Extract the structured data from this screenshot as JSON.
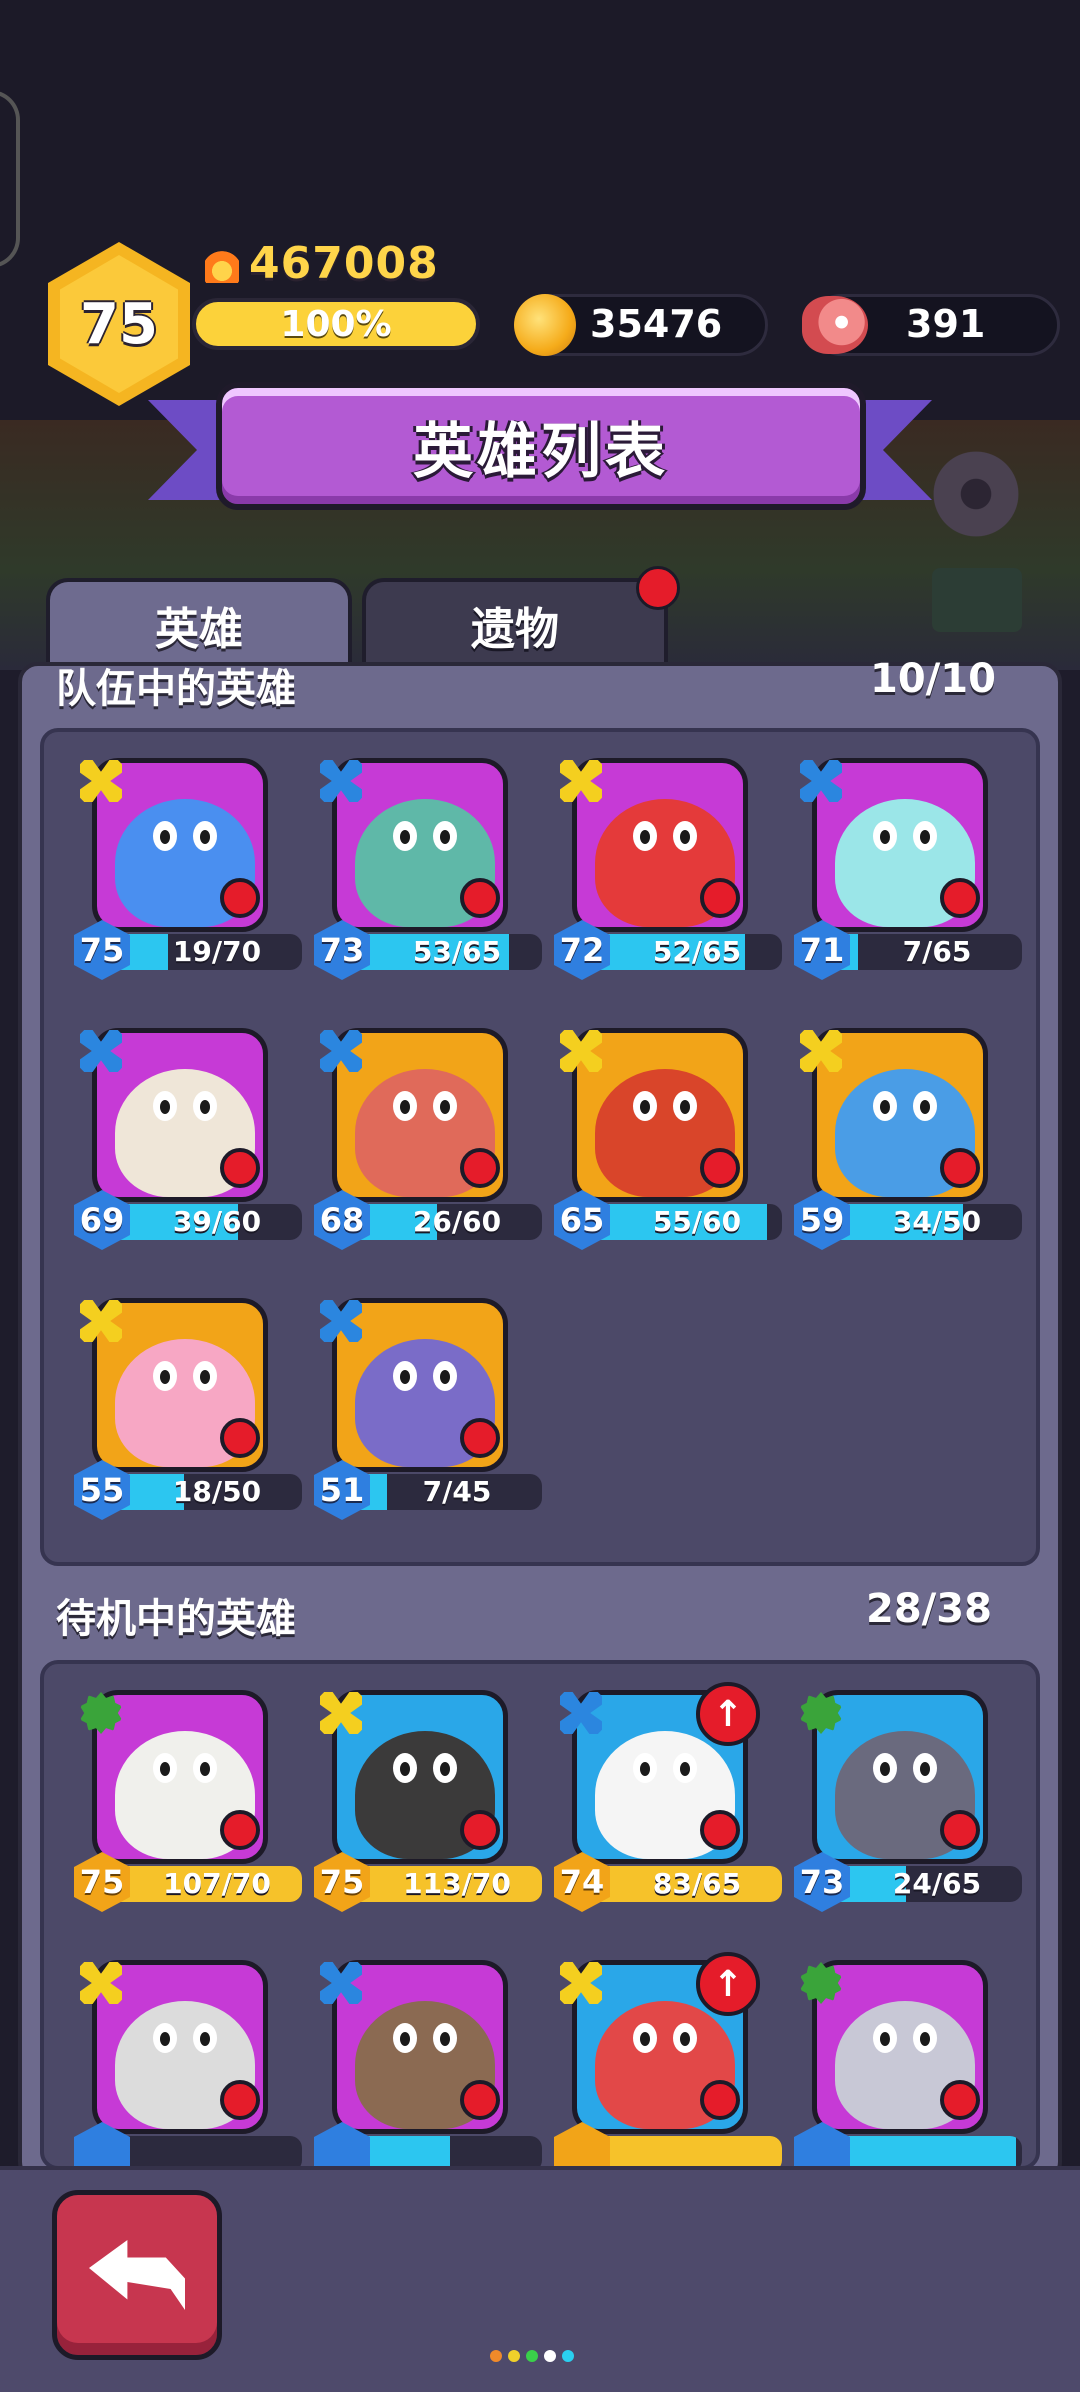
{
  "player": {
    "level": "75",
    "power": "467008",
    "exp_percent": "100%"
  },
  "resources": {
    "coins": "35476",
    "meat": "391"
  },
  "title": "英雄列表",
  "tabs": [
    {
      "label": "英雄"
    },
    {
      "label": "遗物"
    }
  ],
  "team": {
    "title": "队伍中的英雄",
    "count": "10/10",
    "heroes": [
      {
        "level": "75",
        "progress": "19/70",
        "cls": "x",
        "bg": "p",
        "body": "#4a8ff0",
        "fill": 0.27
      },
      {
        "level": "73",
        "progress": "53/65",
        "cls": "b",
        "bg": "p",
        "body": "#5fb8a8",
        "fill": 0.82
      },
      {
        "level": "72",
        "progress": "52/65",
        "cls": "x",
        "bg": "p",
        "body": "#e43a3a",
        "fill": 0.8
      },
      {
        "level": "71",
        "progress": "7/65",
        "cls": "b",
        "bg": "p",
        "body": "#9be6e8",
        "fill": 0.11
      },
      {
        "level": "69",
        "progress": "39/60",
        "cls": "b",
        "bg": "p",
        "body": "#efe6d8",
        "fill": 0.65
      },
      {
        "level": "68",
        "progress": "26/60",
        "cls": "b",
        "bg": "o",
        "body": "#e06a5a",
        "fill": 0.43
      },
      {
        "level": "65",
        "progress": "55/60",
        "cls": "x",
        "bg": "o",
        "body": "#d9452a",
        "fill": 0.92
      },
      {
        "level": "59",
        "progress": "34/50",
        "cls": "x",
        "bg": "o",
        "body": "#4a9de6",
        "fill": 0.68
      },
      {
        "level": "55",
        "progress": "18/50",
        "cls": "x",
        "bg": "o",
        "body": "#f7a7c4",
        "fill": 0.36
      },
      {
        "level": "51",
        "progress": "7/45",
        "cls": "b",
        "bg": "o",
        "body": "#7a6cc8",
        "fill": 0.16
      }
    ]
  },
  "standby": {
    "title": "待机中的英雄",
    "count": "28/38",
    "heroes": [
      {
        "level": "75",
        "progress": "107/70",
        "cls": "g",
        "bg": "p",
        "body": "#f0f0ec",
        "fill": 1,
        "gold": true,
        "up": false
      },
      {
        "level": "75",
        "progress": "113/70",
        "cls": "x",
        "bg": "b",
        "body": "#3b3a3a",
        "fill": 1,
        "gold": true,
        "up": false
      },
      {
        "level": "74",
        "progress": "83/65",
        "cls": "b",
        "bg": "b",
        "body": "#f5f5f5",
        "fill": 1,
        "gold": true,
        "up": true
      },
      {
        "level": "73",
        "progress": "24/65",
        "cls": "g",
        "bg": "b",
        "body": "#6a6a7e",
        "fill": 0.37,
        "gold": false,
        "up": false
      },
      {
        "level": "",
        "progress": "",
        "cls": "x",
        "bg": "p",
        "body": "#dcdcdc",
        "fill": 0.05,
        "gold": false,
        "up": false
      },
      {
        "level": "",
        "progress": "",
        "cls": "b",
        "bg": "p",
        "body": "#8b6a52",
        "fill": 0.5,
        "gold": false,
        "up": false
      },
      {
        "level": "",
        "progress": "",
        "cls": "x",
        "bg": "b",
        "body": "#e24848",
        "fill": 1,
        "gold": true,
        "up": true
      },
      {
        "level": "",
        "progress": "",
        "cls": "g",
        "bg": "p",
        "body": "#c8c8d6",
        "fill": 0.97,
        "gold": false,
        "up": false
      }
    ]
  },
  "icons": {
    "class_icons": {
      "x": "crossed-bones-yellow-icon",
      "b": "crossed-bones-blue-icon",
      "g": "skull-gear-green-icon"
    },
    "upgrade": "↑"
  },
  "colors": {
    "panel": "#6d6a8d",
    "title_banner": "#b35ad3",
    "back_button": "#c7364f"
  }
}
